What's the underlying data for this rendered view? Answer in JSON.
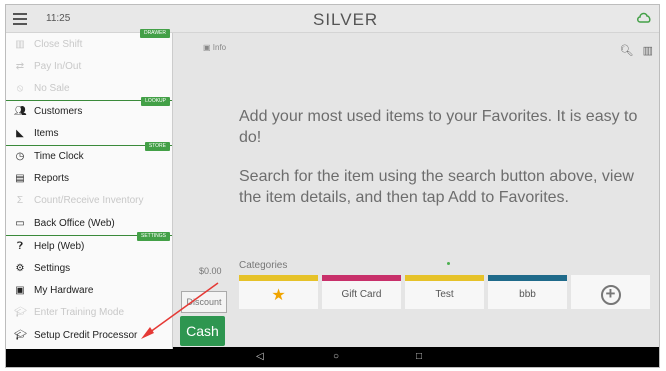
{
  "topbar": {
    "time": "11:25",
    "logo": "SILVER"
  },
  "drawer": {
    "items": [
      {
        "label": "Close Shift",
        "icon": "bank-icon",
        "enabled": false,
        "tag": "DRAWER"
      },
      {
        "label": "Pay In/Out",
        "icon": "swap-icon",
        "enabled": false,
        "tag": ""
      },
      {
        "label": "No Sale",
        "icon": "no-sale-icon",
        "enabled": false,
        "tag": ""
      },
      {
        "label": "Customers",
        "icon": "people-icon",
        "enabled": true,
        "tag": "LOOKUP"
      },
      {
        "label": "Items",
        "icon": "items-icon",
        "enabled": true,
        "tag": ""
      },
      {
        "label": "Time Clock",
        "icon": "clock-icon",
        "enabled": true,
        "tag": "STORE"
      },
      {
        "label": "Reports",
        "icon": "report-icon",
        "enabled": true,
        "tag": ""
      },
      {
        "label": "Count/Receive Inventory",
        "icon": "sigma-icon",
        "enabled": false,
        "tag": ""
      },
      {
        "label": "Back Office (Web)",
        "icon": "back-office-icon",
        "enabled": true,
        "tag": ""
      },
      {
        "label": "Help (Web)",
        "icon": "help-icon",
        "enabled": true,
        "tag": "SETTINGS"
      },
      {
        "label": "Settings",
        "icon": "settings-icon",
        "enabled": true,
        "tag": ""
      },
      {
        "label": "My Hardware",
        "icon": "hardware-icon",
        "enabled": true,
        "tag": ""
      },
      {
        "label": "Enter Training Mode",
        "icon": "training-icon",
        "enabled": false,
        "tag": ""
      },
      {
        "label": "Setup Credit Processor",
        "icon": "graduation-cap-icon",
        "enabled": true,
        "tag": ""
      }
    ]
  },
  "main": {
    "info_tab": "Info",
    "favorites_msg_1": "Add your most used items to your Favorites. It is easy to do!",
    "favorites_msg_2": "Search for the item using the search button above, view the item details, and then tap Add to Favorites.",
    "categories_label": "Categories",
    "categories": [
      {
        "label": "★",
        "color": "#e6c229"
      },
      {
        "label": "Gift Card",
        "color": "#c8306a"
      },
      {
        "label": "Test",
        "color": "#e6c229"
      },
      {
        "label": "bbb",
        "color": "#1f6a8a"
      },
      {
        "label": "+",
        "color": ""
      }
    ],
    "amount": "$0.00",
    "discount_label": "Discount",
    "cash_label": "Cash"
  },
  "colors": {
    "accent": "#2e9650",
    "tag": "#43a047",
    "arrow": "#e53935"
  }
}
